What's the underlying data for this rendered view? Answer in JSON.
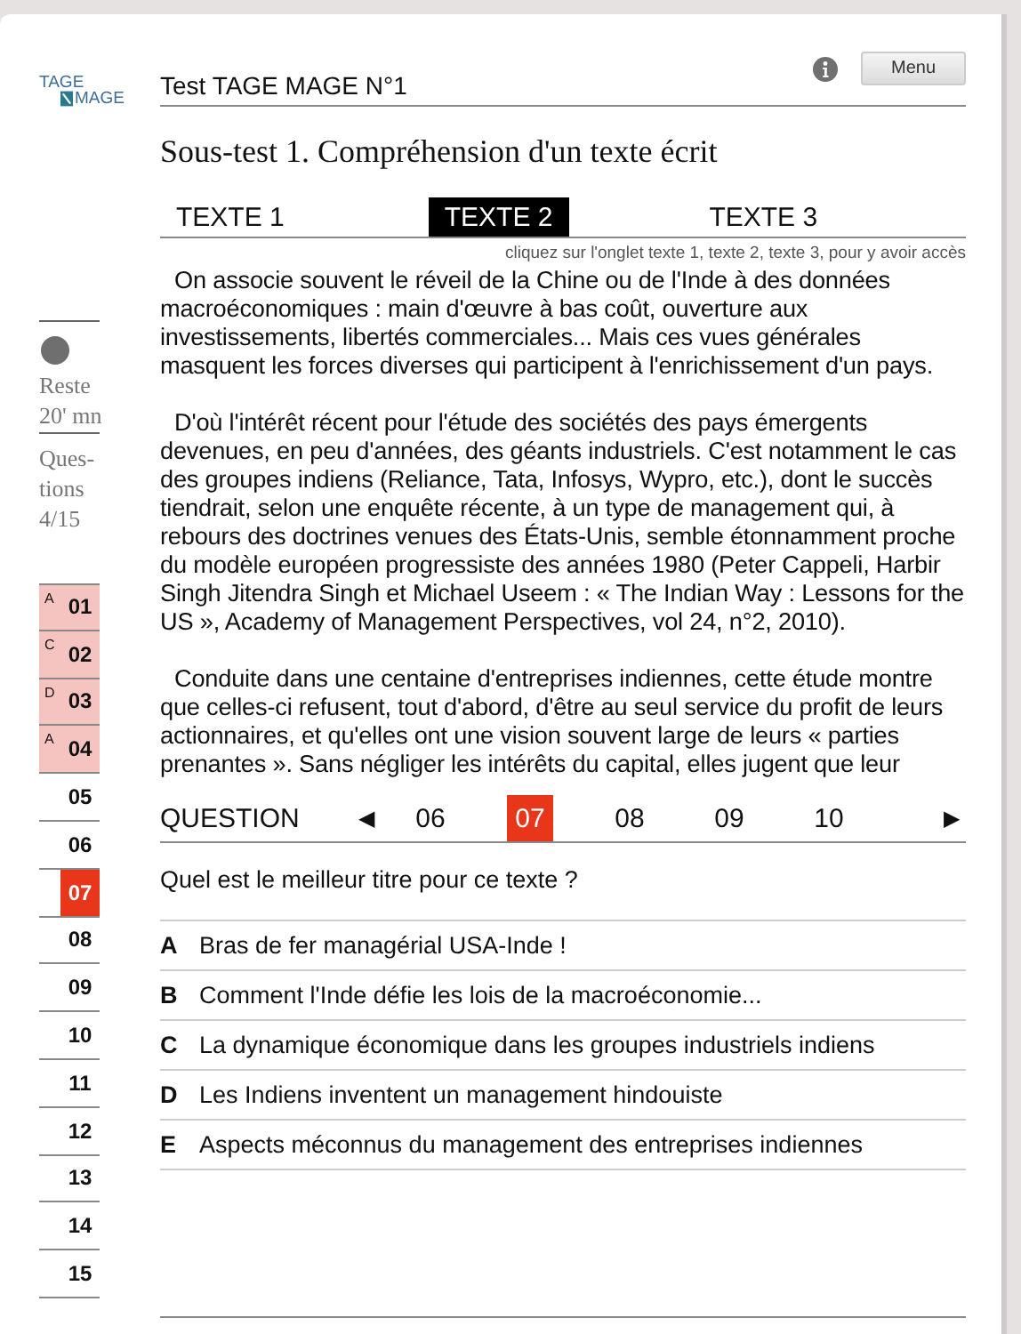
{
  "logo": {
    "top": "TAGE",
    "bottom": "MAGE"
  },
  "header": {
    "title": "Test TAGE MAGE N°1",
    "menu_button": "Menu"
  },
  "subtitle": "Sous-test 1. Compréhension d'un texte écrit",
  "tabs": [
    {
      "label": "TEXTE 1",
      "selected": false
    },
    {
      "label": "TEXTE 2",
      "selected": true
    },
    {
      "label": "TEXTE 3",
      "selected": false
    }
  ],
  "tabs_hint": "cliquez sur l'onglet texte 1, texte 2, texte 3, pour y avoir accès",
  "passage": [
    "On associe souvent le réveil de la Chine ou de l'Inde à des données macroéconomiques : main d'œuvre à bas coût, ouverture aux investissements, libertés commerciales... Mais ces vues générales masquent les forces diverses qui participent à l'enrichissement d'un pays.",
    "D'où l'intérêt récent pour l'étude des sociétés des pays émergents devenues, en peu d'années, des géants industriels. C'est notamment le cas des groupes indiens (Reliance, Tata, Infosys, Wypro, etc.), dont le succès tiendrait, selon une enquête récente, à un type de management qui, à rebours des doctrines venues des États-Unis, semble étonnamment proche du modèle européen progressiste des années 1980 (Peter Cappeli, Harbir Singh Jitendra Singh et Michael Useem : « The Indian Way : Lessons for the US », Academy of Management Perspectives, vol 24, n°2, 2010).",
    "Conduite dans une centaine d'entreprises indiennes, cette étude montre que celles-ci refusent, tout d'abord, d'être au seul service du profit de leurs actionnaires, et qu'elles ont une vision souvent large de leurs « parties prenantes ». Sans négliger les intérêts du capital, elles jugent que leur"
  ],
  "sidebar": {
    "timer_label": "Reste",
    "timer_value": "20' mn",
    "questions_label": "Ques-tions",
    "questions_count": "4/15"
  },
  "question_list": [
    {
      "number": "01",
      "answer": "A",
      "selected": false
    },
    {
      "number": "02",
      "answer": "C",
      "selected": false
    },
    {
      "number": "03",
      "answer": "D",
      "selected": false
    },
    {
      "number": "04",
      "answer": "A",
      "selected": false
    },
    {
      "number": "05",
      "selected": false
    },
    {
      "number": "06",
      "selected": false
    },
    {
      "number": "07",
      "selected": true
    },
    {
      "number": "08",
      "selected": false
    },
    {
      "number": "09",
      "selected": false
    },
    {
      "number": "10",
      "selected": false
    },
    {
      "number": "11",
      "selected": false
    },
    {
      "number": "12",
      "selected": false
    },
    {
      "number": "13",
      "selected": false
    },
    {
      "number": "14",
      "selected": false
    },
    {
      "number": "15",
      "selected": false
    }
  ],
  "question_nav": {
    "label": "QUESTION",
    "prev": "◀",
    "next": "▶",
    "items": [
      {
        "number": "06",
        "selected": false
      },
      {
        "number": "07",
        "selected": true
      },
      {
        "number": "08",
        "selected": false
      },
      {
        "number": "09",
        "selected": false
      },
      {
        "number": "10",
        "selected": false
      }
    ]
  },
  "question": "Quel est le meilleur titre pour ce texte ?",
  "options": [
    {
      "letter": "A",
      "text": "Bras de fer managérial USA-Inde !"
    },
    {
      "letter": "B",
      "text": "Comment l'Inde défie les lois de la macroéconomie..."
    },
    {
      "letter": "C",
      "text": "La dynamique économique dans les groupes industriels indiens"
    },
    {
      "letter": "D",
      "text": "Les Indiens inventent un management hindouiste"
    },
    {
      "letter": "E",
      "text": "Aspects méconnus du management des entreprises indiennes"
    }
  ]
}
